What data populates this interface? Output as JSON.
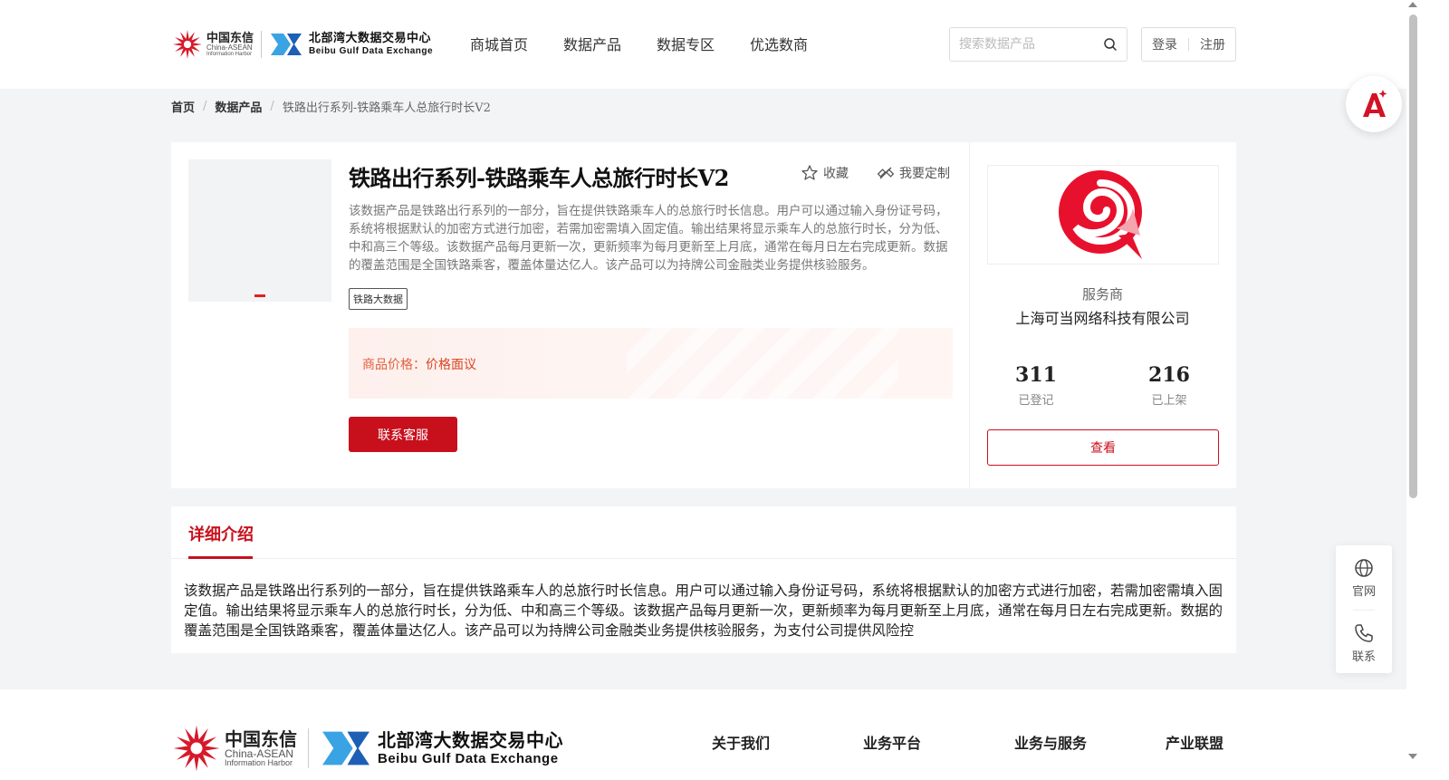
{
  "header": {
    "logo_chinatel_cn": "中国东信",
    "logo_chinatel_en1": "China-ASEAN",
    "logo_chinatel_en2": "Information Harbor",
    "logo_beibu_cn": "北部湾大数据交易中心",
    "logo_beibu_en": "Beibu Gulf Data Exchange",
    "nav": [
      "商城首页",
      "数据产品",
      "数据专区",
      "优选数商"
    ],
    "search_placeholder": "搜索数据产品",
    "login": "登录",
    "register": "注册"
  },
  "breadcrumb": {
    "home": "首页",
    "category": "数据产品",
    "current": "铁路出行系列-铁路乘车人总旅行时长V2",
    "separator": "/"
  },
  "product": {
    "title": "铁路出行系列-铁路乘车人总旅行时长V2",
    "favorite": "收藏",
    "customize": "我要定制",
    "description": "该数据产品是铁路出行系列的一部分，旨在提供铁路乘车人的总旅行时长信息。用户可以通过输入身份证号码，系统将根据默认的加密方式进行加密，若需加密需填入固定值。输出结果将显示乘车人的总旅行时长，分为低、中和高三个等级。该数据产品每月更新一次，更新频率为每月更新至上月底，通常在每月日左右完成更新。数据的覆盖范围是全国铁路乘客，覆盖体量达亿人。该产品可以为持牌公司金融类业务提供核验服务。",
    "tag": "铁路大数据",
    "price_label": "商品价格：",
    "price_value": "价格面议",
    "contact": "联系客服"
  },
  "provider": {
    "role": "服务商",
    "name": "上海可当网络科技有限公司",
    "registered_count": "311",
    "registered_label": "已登记",
    "listed_count": "216",
    "listed_label": "已上架",
    "view": "查看"
  },
  "detail": {
    "tab": "详细介绍",
    "text": "该数据产品是铁路出行系列的一部分，旨在提供铁路乘车人的总旅行时长信息。用户可以通过输入身份证号码，系统将根据默认的加密方式进行加密，若需加密需填入固定值。输出结果将显示乘车人的总旅行时长，分为低、中和高三个等级。该数据产品每月更新一次，更新频率为每月更新至上月底，通常在每月日左右完成更新。数据的覆盖范围是全国铁路乘客，覆盖体量达亿人。该产品可以为持牌公司金融类业务提供核验服务，为支付公司提供风险控"
  },
  "footer": {
    "nav": [
      "关于我们",
      "业务平台",
      "业务与服务",
      "产业联盟"
    ]
  },
  "float": {
    "website": "官网",
    "contact": "联系"
  },
  "colors": {
    "brand_red": "#c8101d",
    "price_orange": "#e5603d"
  }
}
